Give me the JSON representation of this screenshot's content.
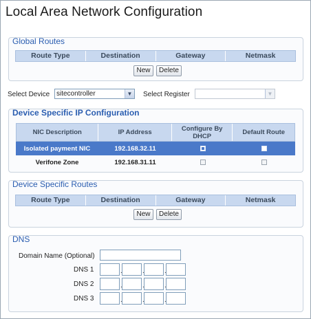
{
  "page": {
    "title": "Local Area Network Configuration"
  },
  "global_routes": {
    "title": "Global Routes",
    "columns": [
      "Route Type",
      "Destination",
      "Gateway",
      "Netmask"
    ],
    "buttons": {
      "new": "New",
      "delete": "Delete"
    }
  },
  "selectors": {
    "device_label": "Select Device",
    "device_value": "sitecontroller",
    "register_label": "Select Register",
    "register_value": ""
  },
  "ip_config": {
    "title": "Device Specific IP Configuration",
    "columns": [
      "NIC Description",
      "IP Address",
      "Configure By DHCP",
      "Default Route"
    ],
    "rows": [
      {
        "nic": "Isolated payment NIC",
        "ip": "192.168.32.11",
        "dhcp": true,
        "default_route": false,
        "selected": true
      },
      {
        "nic": "Verifone Zone",
        "ip": "192.168.31.11",
        "dhcp": false,
        "default_route": false,
        "selected": false
      }
    ]
  },
  "device_routes": {
    "title": "Device Specific Routes",
    "columns": [
      "Route Type",
      "Destination",
      "Gateway",
      "Netmask"
    ],
    "buttons": {
      "new": "New",
      "delete": "Delete"
    }
  },
  "dns": {
    "title": "DNS",
    "domain_label": "Domain Name (Optional)",
    "domain_value": "",
    "dns1_label": "DNS 1",
    "dns2_label": "DNS 2",
    "dns3_label": "DNS 3"
  }
}
